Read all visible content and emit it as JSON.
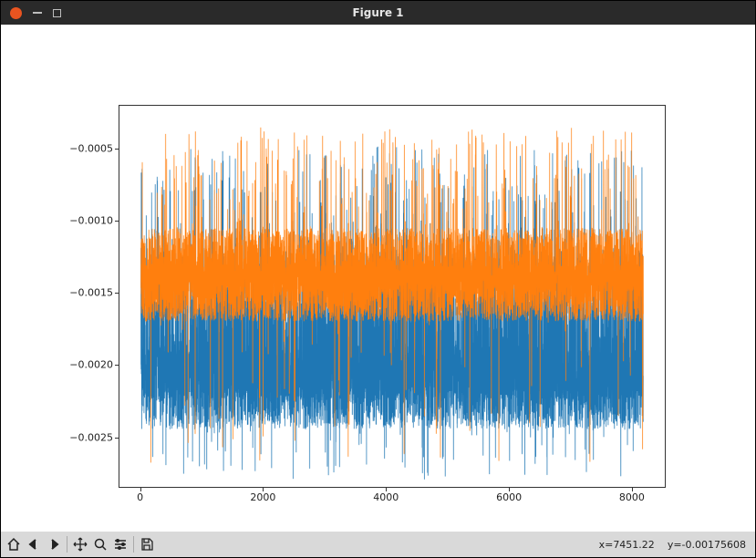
{
  "window": {
    "title": "Figure 1"
  },
  "toolbar": {
    "buttons": [
      {
        "name": "home-button",
        "icon": "home-icon"
      },
      {
        "name": "back-button",
        "icon": "arrow-left-icon"
      },
      {
        "name": "forward-button",
        "icon": "arrow-right-icon"
      },
      {
        "name": "pan-button",
        "icon": "move-icon"
      },
      {
        "name": "zoom-button",
        "icon": "zoom-icon"
      },
      {
        "name": "configure-button",
        "icon": "sliders-icon"
      },
      {
        "name": "save-button",
        "icon": "save-icon"
      }
    ],
    "coord_x_label": "x=",
    "coord_y_label": "y=",
    "coord_x": "7451.22",
    "coord_y": "-0.00175608"
  },
  "chart_data": {
    "type": "line",
    "title": "",
    "xlabel": "",
    "ylabel": "",
    "n_points": 8200,
    "xlim": [
      -350,
      8550
    ],
    "ylim": [
      -0.00285,
      -0.0002
    ],
    "xticks": [
      0,
      2000,
      4000,
      6000,
      8000
    ],
    "yticks": [
      -0.0005,
      -0.001,
      -0.0015,
      -0.002,
      -0.0025
    ],
    "series": [
      {
        "name": "series0",
        "color": "#1f77b4",
        "description": "Dense noisy signal ~8200 samples, baseline around -0.00205 with frequent spikes up to ~-0.0012 and down to ~-0.00245; occasional extremes near -0.0005 and -0.0028.",
        "stats": {
          "median": -0.00205,
          "p10": -0.00245,
          "p90": -0.0012,
          "min": -0.0028,
          "max": -0.00048
        }
      },
      {
        "name": "series1",
        "color": "#ff7f0e",
        "description": "Overlaid noisy signal ~8200 samples, baseline around -0.00140 with frequent spikes; dense band roughly -0.00170 to -0.00105; extremes near -0.00035 and -0.00270.",
        "stats": {
          "median": -0.0014,
          "p10": -0.0017,
          "p90": -0.00105,
          "min": -0.0027,
          "max": -0.00035
        }
      }
    ],
    "colors": {
      "series0": "#1f77b4",
      "series1": "#ff7f0e"
    }
  }
}
